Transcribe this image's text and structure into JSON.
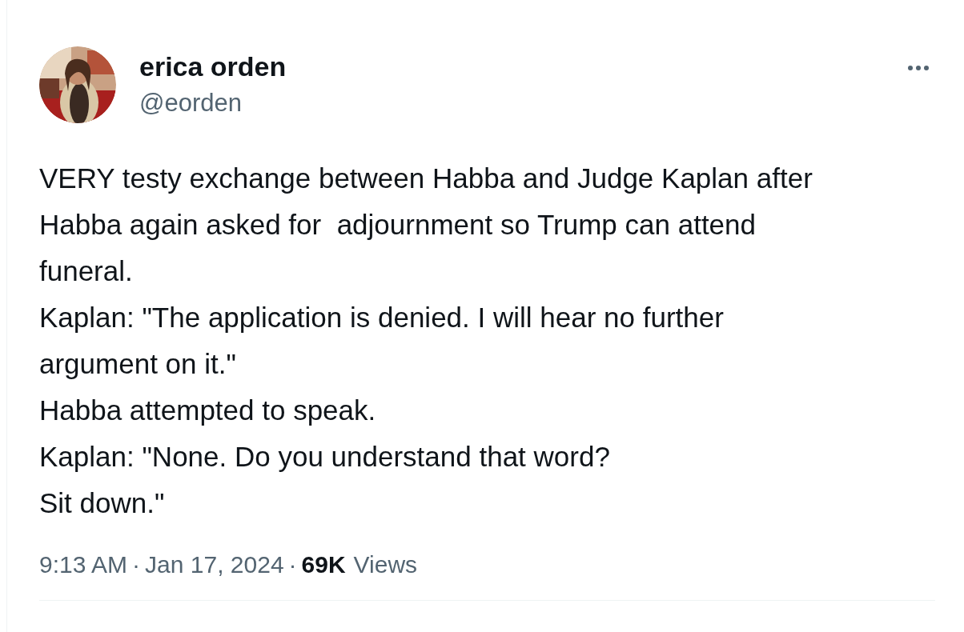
{
  "author": {
    "name": "erica orden",
    "handle": "@eorden"
  },
  "tweet": {
    "text": "VERY testy exchange between Habba and Judge Kaplan after\nHabba again asked for  adjournment so Trump can attend\nfuneral.\nKaplan: \"The application is denied. I will hear no further\nargument on it.\"\nHabba attempted to speak.\nKaplan: \"None. Do you understand that word?\nSit down.\""
  },
  "footer": [
    {
      "kind": "muted",
      "text": "9:13 AM"
    },
    {
      "kind": "separator",
      "text": "·"
    },
    {
      "kind": "muted",
      "text": "Jan 17, 2024"
    },
    {
      "kind": "separator",
      "text": "·"
    },
    {
      "kind": "strong",
      "text": "69K"
    },
    {
      "kind": "muted",
      "text": "Views"
    }
  ]
}
